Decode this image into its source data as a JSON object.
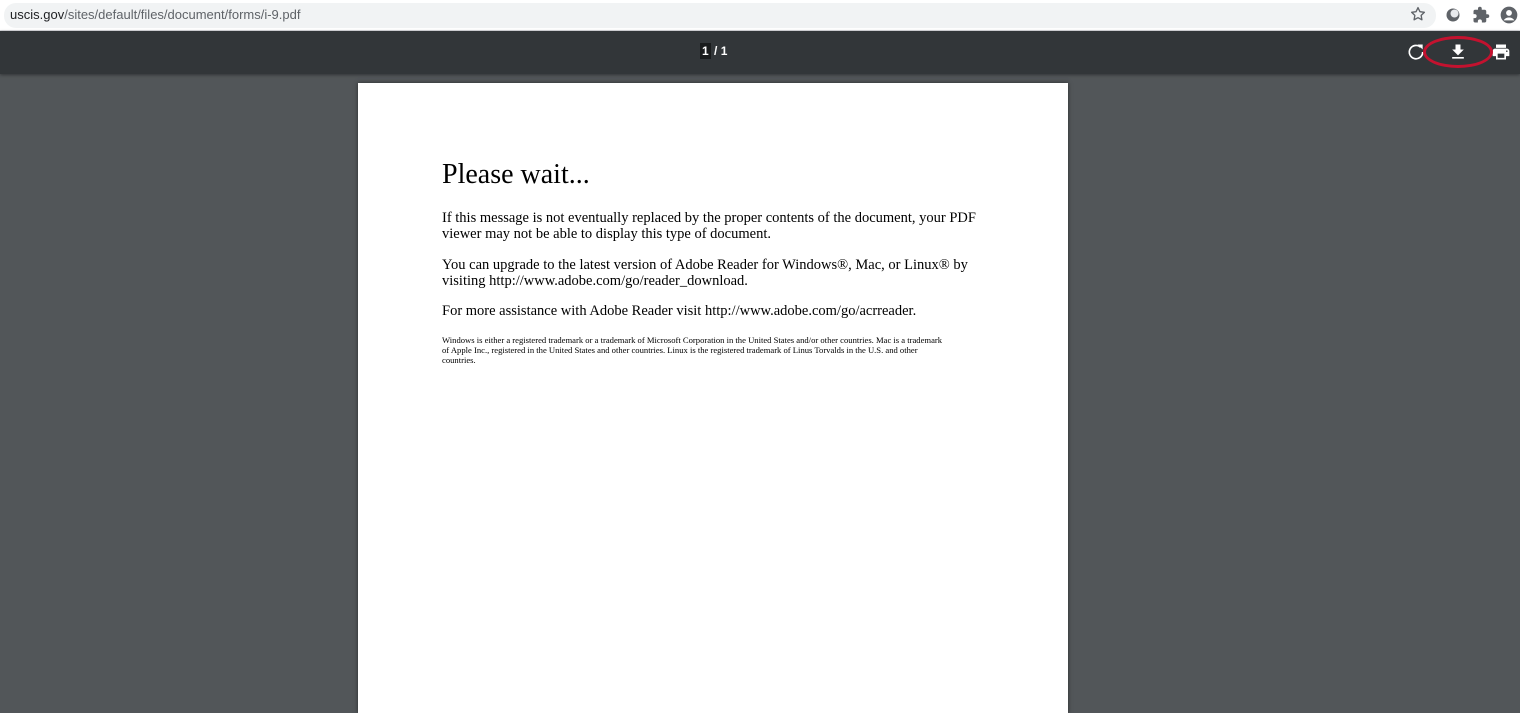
{
  "browser": {
    "url_host": "uscis.gov",
    "url_path": "/sites/default/files/document/forms/i-9.pdf",
    "icons": [
      "star-icon",
      "extension-circle-icon",
      "puzzle-icon",
      "profile-icon"
    ]
  },
  "pdf_toolbar": {
    "page_current": "1",
    "page_separator": " / ",
    "page_total": "1",
    "icons": [
      "rotate-icon",
      "download-icon",
      "print-icon"
    ],
    "highlight_color": "#c4122f"
  },
  "document": {
    "heading": "Please wait...",
    "para1_line1": "If this message is not eventually replaced by the proper contents of the document, your PDF",
    "para1_line2": "viewer may not be able to display this type of document.",
    "para2_line1": "You can upgrade to the latest version of Adobe Reader for Windows®, Mac, or Linux® by",
    "para2_line2": "visiting  http://www.adobe.com/go/reader_download.",
    "para3": "For more assistance with Adobe Reader visit  http://www.adobe.com/go/acrreader.",
    "fine_line1": "Windows is either a registered trademark or a trademark of Microsoft Corporation in the United States and/or other countries. Mac is a trademark",
    "fine_line2": "of Apple Inc., registered in the United States and other countries. Linux is the registered trademark of Linus Torvalds in the U.S. and other",
    "fine_line3": "countries."
  }
}
